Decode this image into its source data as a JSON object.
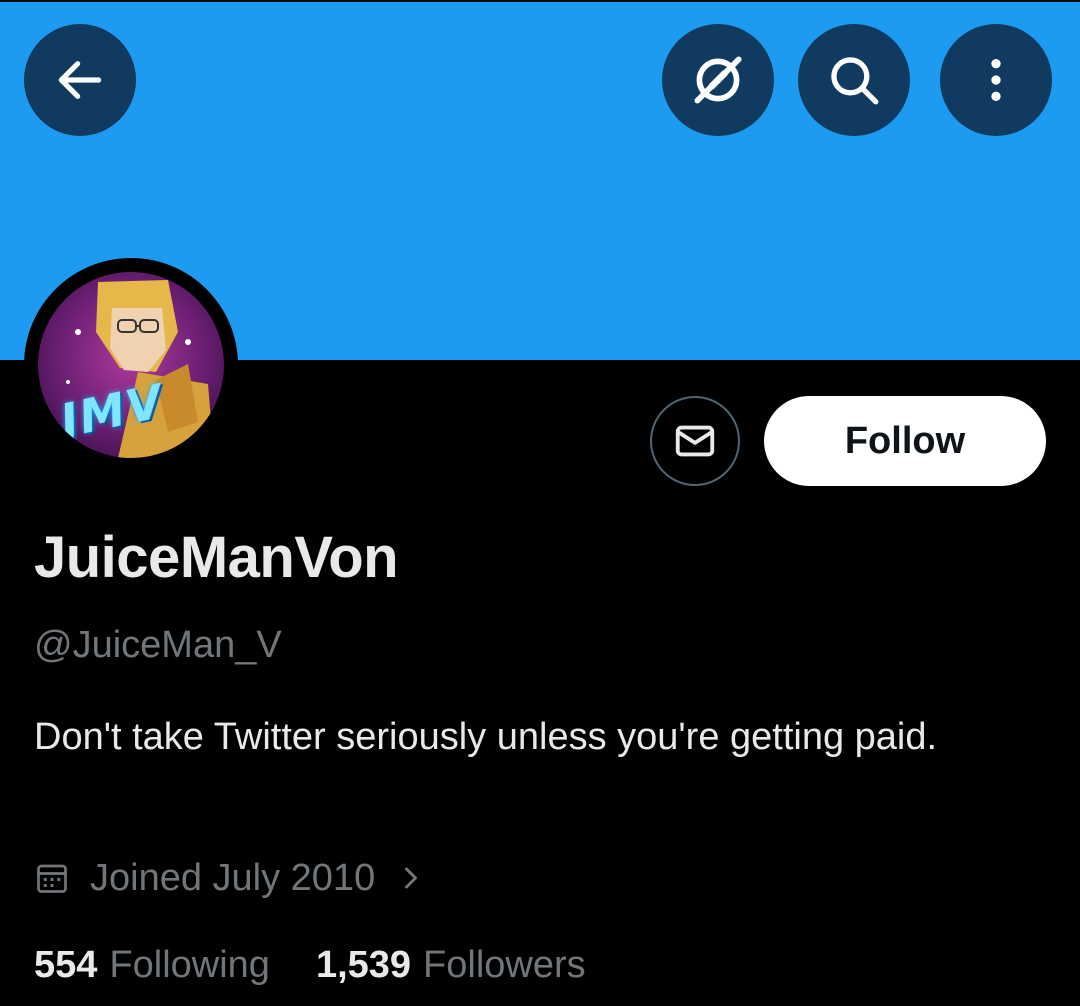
{
  "profile": {
    "display_name": "JuiceManVon",
    "handle": "@JuiceMan_V",
    "bio": "Don't take Twitter seriously unless you're getting paid.",
    "joined": "Joined July 2010",
    "avatar_text": "JMV"
  },
  "actions": {
    "follow_label": "Follow"
  },
  "stats": {
    "following_count": "554",
    "following_label": "Following",
    "followers_count": "1,539",
    "followers_label": "Followers"
  },
  "icons": {
    "back": "back-arrow-icon",
    "grok": "grok-icon",
    "search": "search-icon",
    "more": "more-vertical-icon",
    "message": "envelope-icon",
    "calendar": "calendar-icon",
    "chevron": "chevron-right-icon"
  },
  "colors": {
    "banner": "#1d9bf0",
    "background": "#000000",
    "primary_text": "#e7e9ea",
    "secondary_text": "#71767b",
    "follow_button": "#ffffff"
  }
}
